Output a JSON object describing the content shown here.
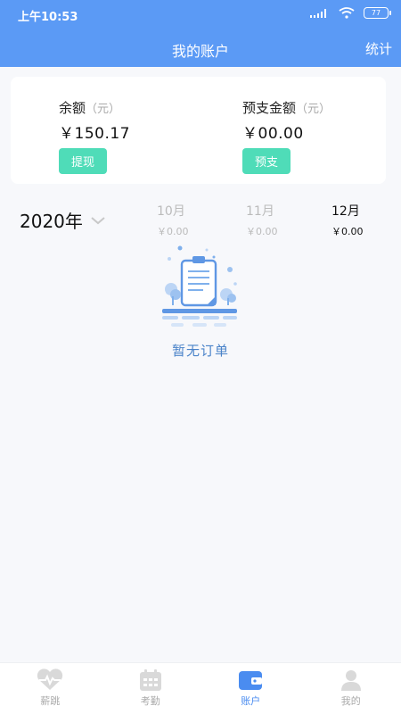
{
  "status_bar": {
    "time": "上午10:53",
    "battery": "77",
    "network": ".....ll"
  },
  "nav": {
    "title": "我的账户",
    "right_action": "统计"
  },
  "balance": {
    "label": "余额",
    "unit": "（元）",
    "value": "￥150.17",
    "button": "提现"
  },
  "advance": {
    "label": "预支金额",
    "unit": "（元）",
    "value": "￥00.00",
    "button": "预支"
  },
  "year": "2020年",
  "months": [
    {
      "name": "10月",
      "amount": "￥0.00",
      "active": false
    },
    {
      "name": "11月",
      "amount": "￥0.00",
      "active": false
    },
    {
      "name": "12月",
      "amount": "￥0.00",
      "active": true
    }
  ],
  "empty_text": "暂无订单",
  "tabs": [
    {
      "label": "薪跳",
      "icon": "heart-pulse-icon"
    },
    {
      "label": "考勤",
      "icon": "calendar-icon"
    },
    {
      "label": "账户",
      "icon": "wallet-icon"
    },
    {
      "label": "我的",
      "icon": "person-icon"
    }
  ],
  "active_tab": "账户",
  "colors": {
    "primary": "#5b9af5",
    "button_green": "#4fdcb8",
    "active_tab": "#4a8cf0",
    "empty_text": "#4a83c9"
  }
}
